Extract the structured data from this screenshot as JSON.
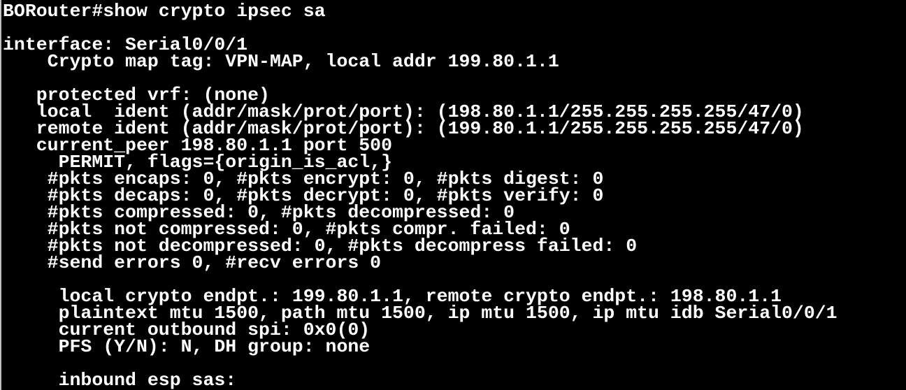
{
  "console": {
    "lines": [
      "BORouter#show crypto ipsec sa",
      "",
      "interface: Serial0/0/1",
      "    Crypto map tag: VPN-MAP, local addr 199.80.1.1",
      "",
      "   protected vrf: (none)",
      "   local  ident (addr/mask/prot/port): (198.80.1.1/255.255.255.255/47/0)",
      "   remote ident (addr/mask/prot/port): (199.80.1.1/255.255.255.255/47/0)",
      "   current_peer 198.80.1.1 port 500",
      "     PERMIT, flags={origin_is_acl,}",
      "    #pkts encaps: 0, #pkts encrypt: 0, #pkts digest: 0",
      "    #pkts decaps: 0, #pkts decrypt: 0, #pkts verify: 0",
      "    #pkts compressed: 0, #pkts decompressed: 0",
      "    #pkts not compressed: 0, #pkts compr. failed: 0",
      "    #pkts not decompressed: 0, #pkts decompress failed: 0",
      "    #send errors 0, #recv errors 0",
      "",
      "     local crypto endpt.: 199.80.1.1, remote crypto endpt.: 198.80.1.1",
      "     plaintext mtu 1500, path mtu 1500, ip mtu 1500, ip mtu idb Serial0/0/1",
      "     current outbound spi: 0x0(0)",
      "     PFS (Y/N): N, DH group: none",
      "",
      "     inbound esp sas:"
    ]
  }
}
